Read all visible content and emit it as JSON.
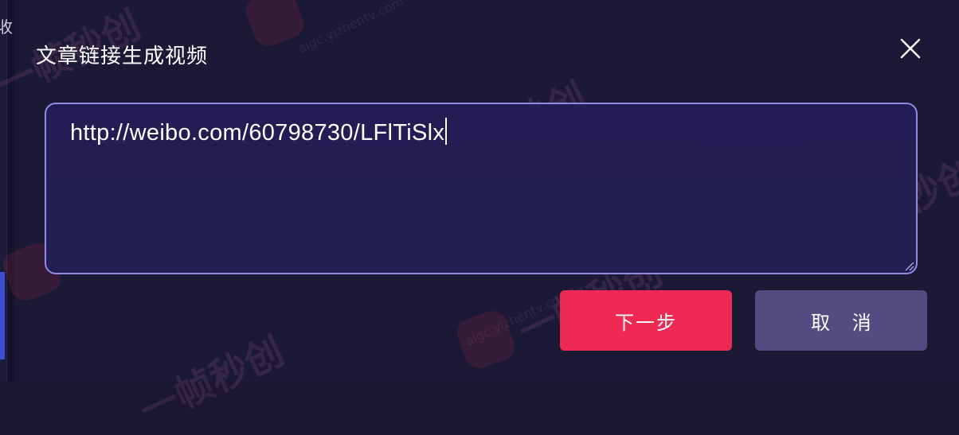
{
  "dialog": {
    "title": "文章链接生成视频",
    "input_value": "http://weibo.com/60798730/LFlTiSlx",
    "next_label": "下一步",
    "cancel_label": "取 消"
  },
  "background": {
    "side_glyph": "收"
  },
  "watermark": {
    "brand": "一帧秒创",
    "domain": "aigc.yizhentv.com"
  },
  "colors": {
    "dialog_bg": "#1c1936",
    "input_border": "#8f8ce6",
    "next_button": "#ef2a52",
    "cancel_button": "#564a82"
  },
  "icons": {
    "close": "close-icon",
    "resize": "resize-grip-icon"
  }
}
